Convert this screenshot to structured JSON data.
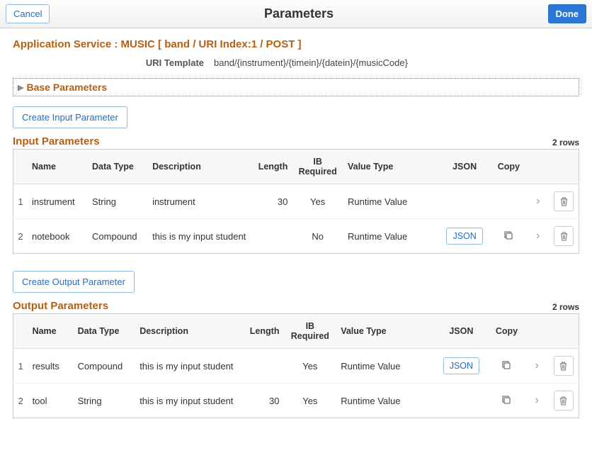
{
  "header": {
    "cancel": "Cancel",
    "title": "Parameters",
    "done": "Done"
  },
  "app_service_label": "Application Service : MUSIC [ band / URI Index:1 / POST ]",
  "uri_template_label": "URI Template",
  "uri_template_value": "band/{instrument}/{timein}/{datein}/{musicCode}",
  "base_parameters_label": "Base Parameters",
  "input": {
    "create_btn": "Create Input Parameter",
    "title": "Input Parameters",
    "row_count": "2 rows",
    "columns": {
      "name": "Name",
      "data_type": "Data Type",
      "description": "Description",
      "length": "Length",
      "ib_required": "IB Required",
      "value_type": "Value Type",
      "json": "JSON",
      "copy": "Copy"
    },
    "rows": [
      {
        "idx": "1",
        "name": "instrument",
        "data_type": "String",
        "description": "instrument",
        "length": "30",
        "ib_required": "Yes",
        "value_type": "Runtime Value",
        "json": "",
        "copy": ""
      },
      {
        "idx": "2",
        "name": "notebook",
        "data_type": "Compound",
        "description": "this is my input student",
        "length": "",
        "ib_required": "No",
        "value_type": "Runtime Value",
        "json": "JSON",
        "copy": "yes"
      }
    ]
  },
  "output": {
    "create_btn": "Create Output Parameter",
    "title": "Output Parameters",
    "row_count": "2 rows",
    "columns": {
      "name": "Name",
      "data_type": "Data Type",
      "description": "Description",
      "length": "Length",
      "ib_required": "IB Required",
      "value_type": "Value Type",
      "json": "JSON",
      "copy": "Copy"
    },
    "rows": [
      {
        "idx": "1",
        "name": "results",
        "data_type": "Compound",
        "description": "this is my input student",
        "length": "",
        "ib_required": "Yes",
        "value_type": "Runtime Value",
        "json": "JSON",
        "copy": "yes"
      },
      {
        "idx": "2",
        "name": "tool",
        "data_type": "String",
        "description": "this is my input student",
        "length": "30",
        "ib_required": "Yes",
        "value_type": "Runtime Value",
        "json": "",
        "copy": "yes"
      }
    ]
  }
}
